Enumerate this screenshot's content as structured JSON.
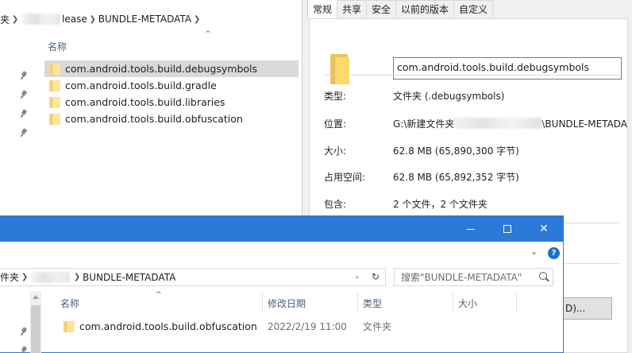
{
  "back_window": {
    "breadcrumb": {
      "part1": "夹",
      "part2": "lease",
      "part3": "BUNDLE-METADATA"
    },
    "column_name": "名称",
    "items": [
      "com.android.tools.build.debugsymbols",
      "com.android.tools.build.gradle",
      "com.android.tools.build.libraries",
      "com.android.tools.build.obfuscation"
    ],
    "selected_index": 0
  },
  "properties": {
    "tabs": [
      "常规",
      "共享",
      "安全",
      "以前的版本",
      "自定义"
    ],
    "active_tab": "常规",
    "name": "com.android.tools.build.debugsymbols",
    "type_label": "类型:",
    "type_value": "文件夹 (.debugsymbols)",
    "location_label": "位置:",
    "location_prefix": "G:\\新建文件夹",
    "location_suffix": "\\BUNDLE-METADA",
    "size_label": "大小:",
    "size_value": "62.8 MB (65,890,300 字节)",
    "disk_label": "占用空间:",
    "disk_value": "62.8 MB (65,892,352 字节)",
    "contains_label": "包含:",
    "contains_value": "2 个文件，2 个文件夹",
    "button_partial": "D)..."
  },
  "front_window": {
    "breadcrumb": {
      "part1": "件夹",
      "part2": "BUNDLE-METADATA"
    },
    "search_placeholder": "搜索\"BUNDLE-METADATA\"",
    "columns": {
      "name": "名称",
      "date": "修改日期",
      "type": "类型",
      "size": "大小"
    },
    "row": {
      "name": "com.android.tools.build.obfuscation",
      "date": "2022/2/19 11:00",
      "type": "文件夹"
    },
    "help": "?"
  },
  "colors": {
    "title_bar": "#2b7ad8",
    "selection": "#d9d9d9",
    "folder": "#ffd86b"
  }
}
